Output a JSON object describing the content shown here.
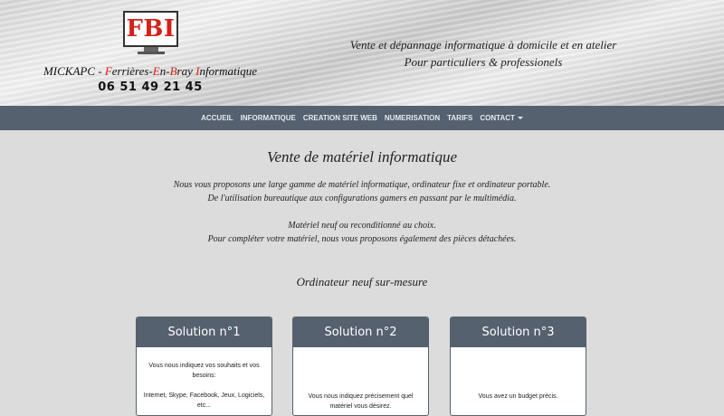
{
  "header": {
    "logo_text": "FBI",
    "company_prefix": "MICKAPC - ",
    "company_parts": [
      {
        "initial": "F",
        "rest": "errières-"
      },
      {
        "initial": "E",
        "rest": "n-"
      },
      {
        "initial": "B",
        "rest": "ray "
      },
      {
        "initial": "I",
        "rest": "nformatique"
      }
    ],
    "phone": "06 51 49 21 45",
    "tagline_1": "Vente et dépannage informatique à domicile et en atelier",
    "tagline_2": "Pour particuliers & professionels"
  },
  "nav": {
    "items": [
      "ACCUEIL",
      "INFORMATIQUE",
      "CREATION SITE WEB",
      "NUMERISATION",
      "TARIFS",
      "CONTACT"
    ]
  },
  "main": {
    "title": "Vente de matériel informatique",
    "para1_line1": "Nous vous proposons une large gamme de matériel informatique, ordinateur fixe et ordinateur portable.",
    "para1_line2": "De l'utilisation bureautique aux configurations gamers en passant par le multimédia.",
    "para2_line1": "Matériel neuf ou reconditionné au choix.",
    "para2_line2": "Pour compléter votre matériel, nous vous proposons également des pièces détachées.",
    "subtitle": "Ordinateur neuf sur-mesure"
  },
  "cards": [
    {
      "title": "Solution n°1",
      "line1": "Vous nous indiquez vos souhaits et vos",
      "line2": "besoins:",
      "line3": "",
      "line4": "Internet, Skype, Facebook, Jeux, Logiciels,",
      "line5": "etc..."
    },
    {
      "title": "Solution n°2",
      "line1": "Vous nous indiquez précisement quel",
      "line2": "matériel vous désirez."
    },
    {
      "title": "Solution n°3",
      "line1": "Vous avez un budget précis."
    }
  ]
}
